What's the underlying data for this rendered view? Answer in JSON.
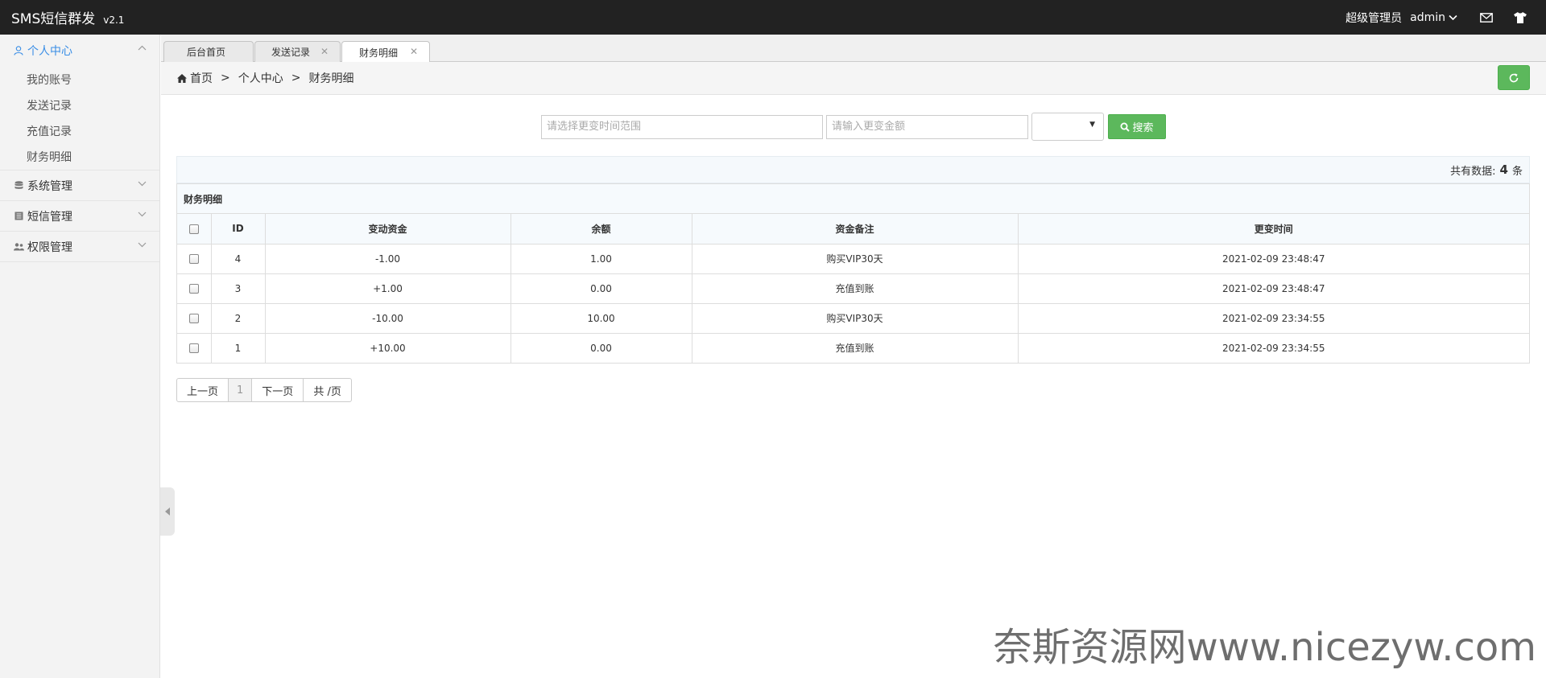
{
  "app": {
    "title": "SMS短信群发",
    "version": "v2.1"
  },
  "topbar": {
    "role": "超级管理员",
    "username": "admin"
  },
  "sidebar": {
    "groups": [
      {
        "label": "个人中心",
        "icon": "user-icon",
        "items": [
          "我的账号",
          "发送记录",
          "充值记录",
          "财务明细"
        ]
      },
      {
        "label": "系统管理",
        "icon": "database-icon"
      },
      {
        "label": "短信管理",
        "icon": "book-icon"
      },
      {
        "label": "权限管理",
        "icon": "users-icon"
      }
    ]
  },
  "tabs": [
    {
      "label": "后台首页",
      "closable": false
    },
    {
      "label": "发送记录",
      "closable": true
    },
    {
      "label": "财务明细",
      "closable": true,
      "active": true
    }
  ],
  "breadcrumb": [
    "首页",
    "个人中心",
    "财务明细"
  ],
  "search": {
    "time_placeholder": "请选择更变时间范围",
    "amount_placeholder": "请输入更变金额",
    "select_value": "",
    "button_label": "搜索"
  },
  "count": {
    "prefix": "共有数据:",
    "value": "4",
    "suffix": "条"
  },
  "table": {
    "title": "财务明细",
    "headers": [
      "ID",
      "变动资金",
      "余额",
      "资金备注",
      "更变时间"
    ],
    "rows": [
      {
        "id": "4",
        "change": "-1.00",
        "balance": "1.00",
        "note": "购买VIP30天",
        "time": "2021-02-09 23:48:47"
      },
      {
        "id": "3",
        "change": "+1.00",
        "balance": "0.00",
        "note": "充值到账",
        "time": "2021-02-09 23:48:47"
      },
      {
        "id": "2",
        "change": "-10.00",
        "balance": "10.00",
        "note": "购买VIP30天",
        "time": "2021-02-09 23:34:55"
      },
      {
        "id": "1",
        "change": "+10.00",
        "balance": "0.00",
        "note": "充值到账",
        "time": "2021-02-09 23:34:55"
      }
    ]
  },
  "pager": {
    "prev": "上一页",
    "current": "1",
    "next": "下一页",
    "total": "共 /页"
  },
  "watermark": "奈斯资源网www.nicezyw.com",
  "colors": {
    "topbar": "#222222",
    "accent": "#3a8ee6",
    "success": "#5cb85c"
  }
}
